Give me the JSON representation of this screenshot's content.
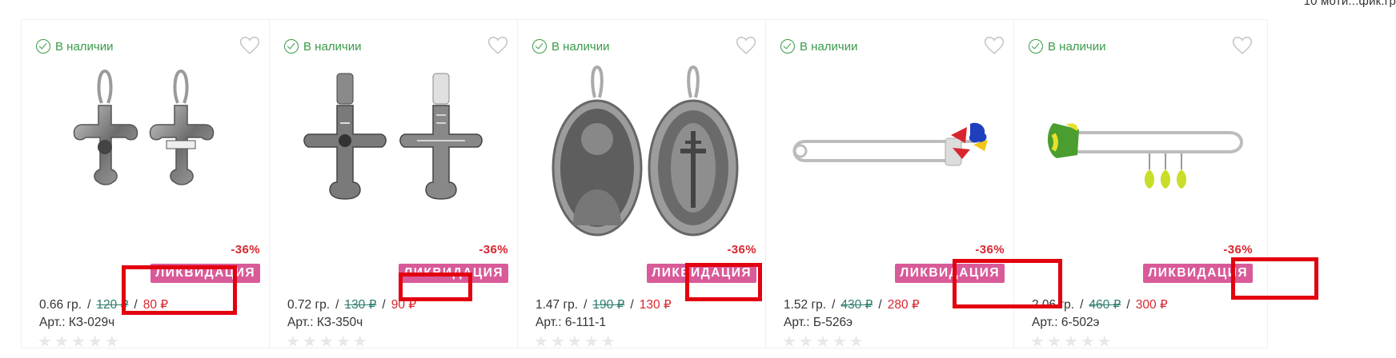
{
  "top_link": "10 моти...фик.гр",
  "products": [
    {
      "stock": "В наличии",
      "discount": "-36%",
      "badge": "ЛИКВИДАЦИЯ",
      "weight": "0.66 гр.",
      "old_price": "120 ₽",
      "new_price": "80 ₽",
      "sku": "Арт.: КЗ-029ч",
      "image": "cross-pair-icon"
    },
    {
      "stock": "В наличии",
      "discount": "-36%",
      "badge": "ЛИКВИДАЦИЯ",
      "weight": "0.72 гр.",
      "old_price": "130 ₽",
      "new_price": "90 ₽",
      "sku": "Арт.: КЗ-350ч",
      "image": "orthodox-cross-pair-icon"
    },
    {
      "stock": "В наличии",
      "discount": "-36%",
      "badge": "ЛИКВИДАЦИЯ",
      "weight": "1.47 гр.",
      "old_price": "190 ₽",
      "new_price": "130 ₽",
      "sku": "Арт.: 6-111-1",
      "image": "icon-medallion-pair"
    },
    {
      "stock": "В наличии",
      "discount": "-36%",
      "badge": "ЛИКВИДАЦИЯ",
      "weight": "1.52 гр.",
      "old_price": "430 ₽",
      "new_price": "280 ₽",
      "sku": "Арт.: Б-526э",
      "image": "safety-pin-butterfly-icon"
    },
    {
      "stock": "В наличии",
      "discount": "-36%",
      "badge": "ЛИКВИДАЦИЯ",
      "weight": "2.06 гр.",
      "old_price": "460 ₽",
      "new_price": "300 ₽",
      "sku": "Арт.: 6-502э",
      "image": "safety-pin-leaves-icon"
    }
  ],
  "colors": {
    "stock_green": "#3a9a4a",
    "price_red": "#d8262f",
    "badge_pink": "#d95a98",
    "highlight_red": "#e3000f",
    "old_price_teal": "#2e7d6e"
  }
}
